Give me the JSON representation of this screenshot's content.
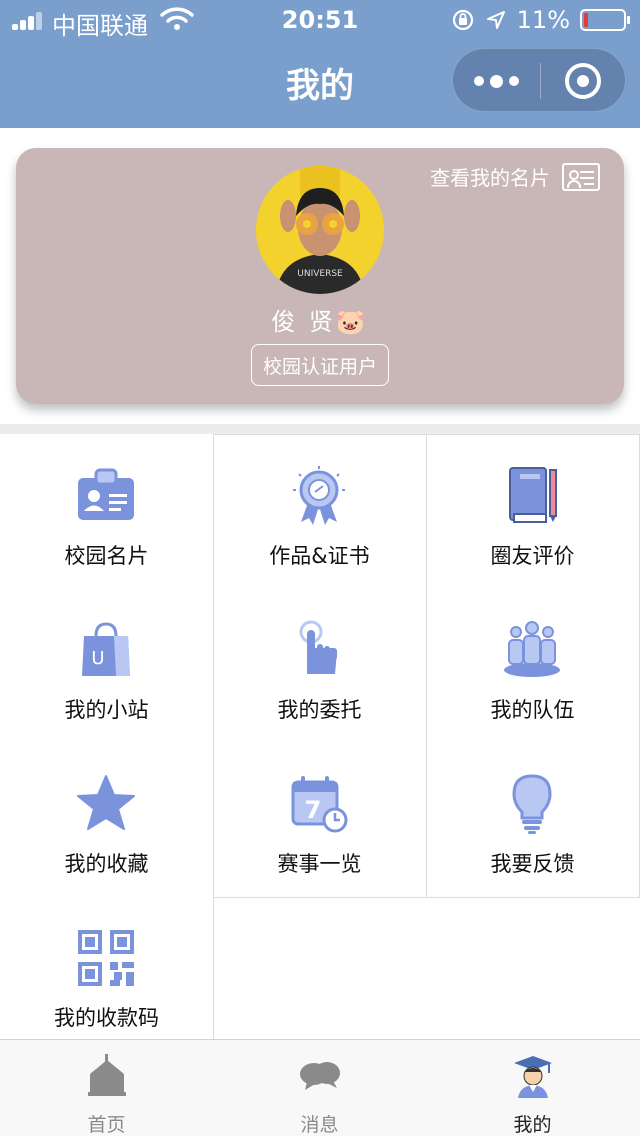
{
  "status_bar": {
    "carrier": "中国联通",
    "time": "20:51",
    "battery_percent": "11%",
    "battery_level": 0.11,
    "icons": [
      "signal-icon",
      "wifi-icon",
      "rotation-lock-icon",
      "location-icon",
      "battery-icon"
    ]
  },
  "nav": {
    "title": "我的",
    "capsule": {
      "more_icon": "more-dots-icon",
      "close_icon": "target-close-icon"
    }
  },
  "profile": {
    "view_card_label": "查看我的名片",
    "view_card_icon": "id-card-icon",
    "name": "俊 贤🐷",
    "badge": "校园认证用户",
    "card_color": "#c8b7b6",
    "avatar_bg": "#f4d22e"
  },
  "menu": [
    {
      "label": "校园名片",
      "icon": "badge-id-icon"
    },
    {
      "label": "作品&证书",
      "icon": "award-ribbon-icon"
    },
    {
      "label": "圈友评价",
      "icon": "notebook-pencil-icon"
    },
    {
      "label": "我的小站",
      "icon": "shopping-bag-icon"
    },
    {
      "label": "我的委托",
      "icon": "tap-hand-icon"
    },
    {
      "label": "我的队伍",
      "icon": "team-people-icon"
    },
    {
      "label": "我的收藏",
      "icon": "star-icon"
    },
    {
      "label": "赛事一览",
      "icon": "calendar-clock-icon"
    },
    {
      "label": "我要反馈",
      "icon": "lightbulb-icon"
    },
    {
      "label": "我的收款码",
      "icon": "qr-code-icon"
    }
  ],
  "tabs": [
    {
      "label": "首页",
      "icon": "house-icon",
      "active": false
    },
    {
      "label": "消息",
      "icon": "chat-bubbles-icon",
      "active": false
    },
    {
      "label": "我的",
      "icon": "graduate-icon",
      "active": true
    }
  ],
  "colors": {
    "header": "#7b9fcd",
    "icon_blue": "#7b93dc",
    "icon_light": "#b8c8f2",
    "tab_gray": "#8a8a8a"
  }
}
